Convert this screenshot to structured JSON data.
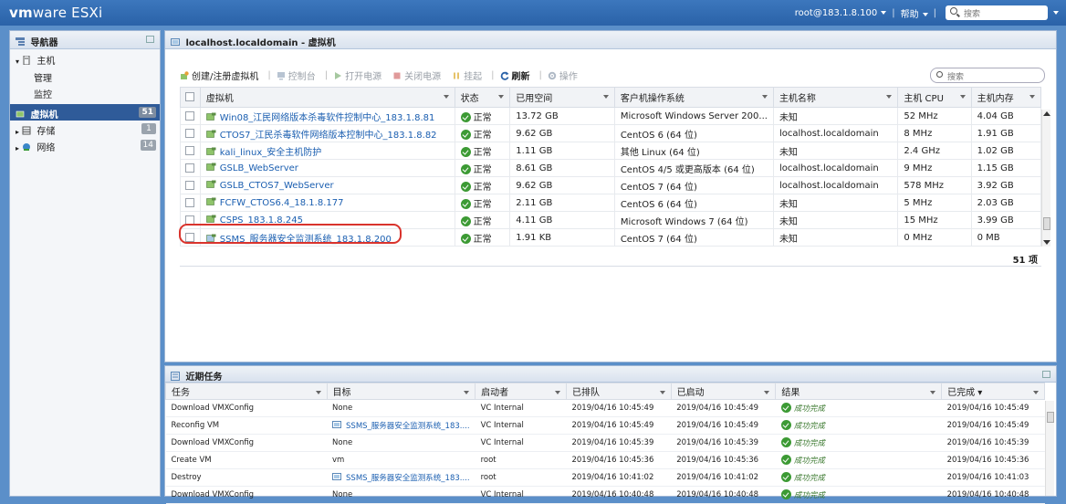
{
  "app": {
    "logo_vm": "vm",
    "logo_ware": "ware",
    "logo_product": "ESXi",
    "user": "root@183.1.8.100",
    "help": "帮助",
    "search_placeholder": "搜索"
  },
  "navigator": {
    "title": "导航器",
    "host": {
      "label": "主机",
      "children": [
        "管理",
        "监控"
      ]
    },
    "items": [
      {
        "label": "虚拟机",
        "count": "51",
        "active": true
      },
      {
        "label": "存储",
        "count": "1",
        "active": false
      },
      {
        "label": "网络",
        "count": "14",
        "active": false
      }
    ]
  },
  "main": {
    "title": "localhost.localdomain - 虚拟机",
    "toolbar": {
      "create": "创建/注册虚拟机",
      "console": "控制台",
      "power_on": "打开电源",
      "power_off": "关闭电源",
      "suspend": "挂起",
      "refresh": "刷新",
      "actions": "操作"
    },
    "search_placeholder": "搜索",
    "columns": [
      "虚拟机",
      "状态",
      "已用空间",
      "客户机操作系统",
      "主机名称",
      "主机 CPU",
      "主机内存"
    ],
    "rows": [
      {
        "name": "Win08_江民网络版本杀毒软件控制中心_183.1.8.81",
        "status": "正常",
        "used": "13.72 GB",
        "os": "Microsoft Windows Server 200...",
        "hostname": "未知",
        "cpu": "52 MHz",
        "mem": "4.04 GB"
      },
      {
        "name": "CTOS7_江民杀毒软件网络版本控制中心_183.1.8.82",
        "status": "正常",
        "used": "9.62 GB",
        "os": "CentOS 6 (64 位)",
        "hostname": "localhost.localdomain",
        "cpu": "8 MHz",
        "mem": "1.91 GB"
      },
      {
        "name": "kali_linux_安全主机防护",
        "status": "正常",
        "used": "1.11 GB",
        "os": "其他 Linux (64 位)",
        "hostname": "未知",
        "cpu": "2.4 GHz",
        "mem": "1.02 GB"
      },
      {
        "name": "GSLB_WebServer",
        "status": "正常",
        "used": "8.61 GB",
        "os": "CentOS 4/5 或更高版本 (64 位)",
        "hostname": "localhost.localdomain",
        "cpu": "9 MHz",
        "mem": "1.15 GB"
      },
      {
        "name": "GSLB_CTOS7_WebServer",
        "status": "正常",
        "used": "9.62 GB",
        "os": "CentOS 7 (64 位)",
        "hostname": "localhost.localdomain",
        "cpu": "578 MHz",
        "mem": "3.92 GB"
      },
      {
        "name": "FCFW_CTOS6.4_18.1.8.177",
        "status": "正常",
        "used": "2.11 GB",
        "os": "CentOS 6 (64 位)",
        "hostname": "未知",
        "cpu": "5 MHz",
        "mem": "2.03 GB"
      },
      {
        "name": "CSPS_183.1.8.245",
        "status": "正常",
        "used": "4.11 GB",
        "os": "Microsoft Windows 7 (64 位)",
        "hostname": "未知",
        "cpu": "15 MHz",
        "mem": "3.99 GB"
      },
      {
        "name": "SSMS_服务器安全监测系统_183.1.8.200",
        "status": "正常",
        "used": "1.91 KB",
        "os": "CentOS 7 (64 位)",
        "hostname": "未知",
        "cpu": "0 MHz",
        "mem": "0 MB"
      }
    ],
    "count_label": "51 项"
  },
  "tasks": {
    "title": "近期任务",
    "columns": [
      "任务",
      "目标",
      "启动者",
      "已排队",
      "已启动",
      "结果",
      "已完成 ▾"
    ],
    "rows": [
      {
        "task": "Download VMXConfig",
        "target": "None",
        "initiator": "VC Internal",
        "queued": "2019/04/16 10:45:49",
        "started": "2019/04/16 10:45:49",
        "result": "成功完成",
        "completed": "2019/04/16 10:45:49"
      },
      {
        "task": "Reconfig VM",
        "target": "SSMS_服务器安全监测系统_183....",
        "initiator": "VC Internal",
        "queued": "2019/04/16 10:45:49",
        "started": "2019/04/16 10:45:49",
        "result": "成功完成",
        "completed": "2019/04/16 10:45:49"
      },
      {
        "task": "Download VMXConfig",
        "target": "None",
        "initiator": "VC Internal",
        "queued": "2019/04/16 10:45:39",
        "started": "2019/04/16 10:45:39",
        "result": "成功完成",
        "completed": "2019/04/16 10:45:39"
      },
      {
        "task": "Create VM",
        "target": "vm",
        "initiator": "root",
        "queued": "2019/04/16 10:45:36",
        "started": "2019/04/16 10:45:36",
        "result": "成功完成",
        "completed": "2019/04/16 10:45:36"
      },
      {
        "task": "Destroy",
        "target": "SSMS_服务器安全监测系统_183....",
        "initiator": "root",
        "queued": "2019/04/16 10:41:02",
        "started": "2019/04/16 10:41:02",
        "result": "成功完成",
        "completed": "2019/04/16 10:41:03"
      },
      {
        "task": "Download VMXConfig",
        "target": "None",
        "initiator": "VC Internal",
        "queued": "2019/04/16 10:40:48",
        "started": "2019/04/16 10:40:48",
        "result": "成功完成",
        "completed": "2019/04/16 10:40:48"
      }
    ]
  },
  "colors": {
    "accent": "#2a62a8",
    "link": "#1a5eb0",
    "ok": "#3c9a34",
    "highlight": "#d9332c"
  }
}
